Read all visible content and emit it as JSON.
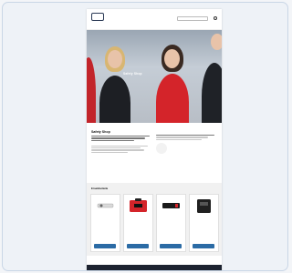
{
  "header": {
    "logo_text": "",
    "util_links": [
      "",
      "",
      ""
    ],
    "search_placeholder": "",
    "nav": [
      "",
      "",
      "",
      ""
    ]
  },
  "hero": {
    "title": "Safety Shop"
  },
  "intro": {
    "breadcrumb": "",
    "heading": "Safety Shop"
  },
  "products": {
    "heading": "Ersatzbetteile",
    "items": [
      {
        "name": "",
        "price": "",
        "image": "device-icon"
      },
      {
        "name": "",
        "price": "",
        "image": "red-case-icon"
      },
      {
        "name": "",
        "price": "",
        "image": "black-case-icon"
      },
      {
        "name": "",
        "price": "",
        "image": "black-device-icon"
      }
    ]
  },
  "footer": {
    "cols": [
      "",
      "",
      ""
    ]
  },
  "colors": {
    "brand_blue": "#2b6ba5",
    "accent_red": "#d4242a",
    "footer_bg": "#1d2330"
  }
}
